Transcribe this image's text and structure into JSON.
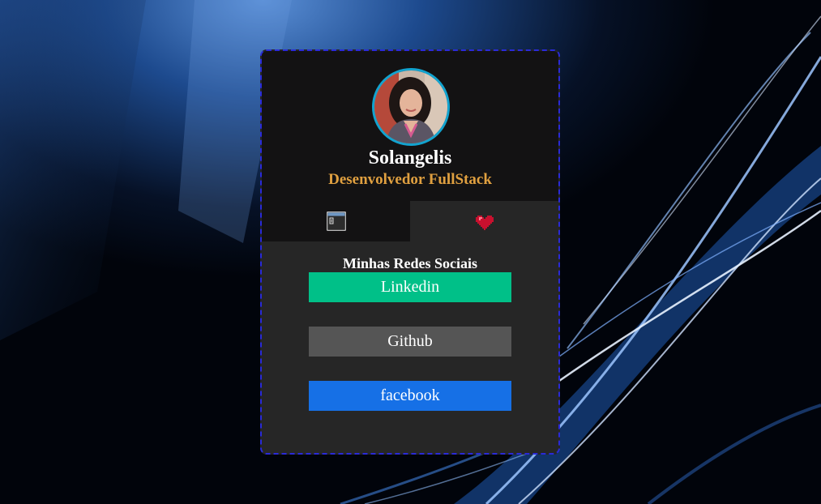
{
  "profile": {
    "name": "Solangelis",
    "role": "Desenvolvedor FullStack"
  },
  "tabs": [
    {
      "id": "projects",
      "icon": "terminal-window-icon"
    },
    {
      "id": "social",
      "icon": "pixel-heart-icon"
    }
  ],
  "social": {
    "title": "Minhas Redes Sociais",
    "links": [
      {
        "label": "Linkedin",
        "color": "#00c088"
      },
      {
        "label": "Github",
        "color": "#555555"
      },
      {
        "label": "facebook",
        "color": "#1670e6"
      }
    ]
  },
  "colors": {
    "card_border": "#2a2ad8",
    "card_header": "#131213",
    "card_body": "#262626",
    "avatar_ring": "#12a3cf",
    "role_text": "#e0a040"
  }
}
